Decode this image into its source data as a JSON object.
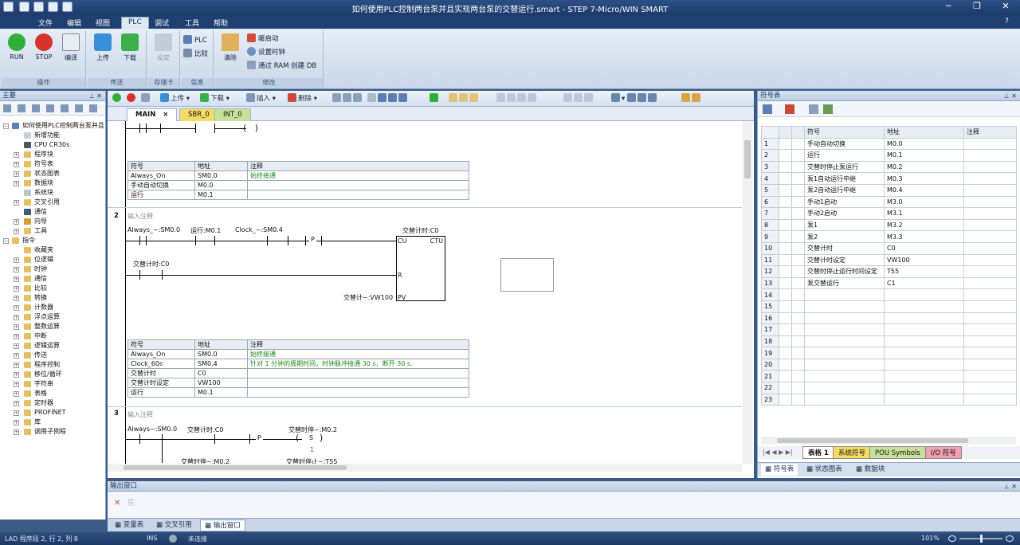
{
  "window": {
    "title": "如何使用PLC控制两台泵并且实现两台泵的交替运行.smart - STEP 7-Micro/WIN SMART"
  },
  "menu": [
    "文件",
    "编辑",
    "视图",
    "PLC",
    "调试",
    "工具",
    "帮助"
  ],
  "ribbon": {
    "run": "RUN",
    "stop": "STOP",
    "compile": "编译",
    "upload": "上传",
    "download": "下载",
    "settings": "设定",
    "plc": "PLC",
    "compare": "比较",
    "clear": "清除",
    "warm_restart": "暖启动",
    "set_clock": "设置时钟",
    "ram_to_db": "通过 RAM 创建 DB",
    "groups": [
      "操作",
      "传送",
      "存储卡",
      "信息",
      "修改"
    ]
  },
  "left_panel": {
    "title": "主要",
    "project_root": "如何使用PLC控制两台泵并且",
    "project_items": [
      "新增功能",
      "CPU CR30s",
      "程序块",
      "符号表",
      "状态图表",
      "数据块",
      "系统块",
      "交叉引用",
      "通信",
      "向导",
      "工具"
    ],
    "instructions_root": "指令",
    "instruction_items": [
      "收藏夹",
      "位逻辑",
      "时钟",
      "通信",
      "比较",
      "转换",
      "计数器",
      "浮点运算",
      "整数运算",
      "中断",
      "逻辑运算",
      "传送",
      "程序控制",
      "移位/循环",
      "字符串",
      "表格",
      "定时器",
      "PROFINET",
      "库",
      "调用子例程"
    ]
  },
  "editor": {
    "toolbar": {
      "upload": "上传",
      "download": "下载",
      "insert": "插入",
      "delete": "删除"
    },
    "tabs": [
      "MAIN",
      "SBR_0",
      "INT_0"
    ],
    "tab_close": "×",
    "net1_table": {
      "headers": [
        "符号",
        "地址",
        "注释"
      ],
      "rows": [
        [
          "Always_On",
          "SM0.0",
          "始终接通"
        ],
        [
          "手动自动切换",
          "M0.0",
          ""
        ],
        [
          "运行",
          "M0.1",
          ""
        ]
      ]
    },
    "net2": {
      "num": "2",
      "comment": "输入注释",
      "contacts": [
        "Always_~:SM0.0",
        "运行:M0.1",
        "Clock_~:SM0.4"
      ],
      "p": "P",
      "counter_title": "交替计时:C0",
      "cu": "CU",
      "ctu": "CTU",
      "r": "R",
      "pv": "PV",
      "reset_contact": "交替计时:C0",
      "pv_input": "交替计~:VW100"
    },
    "net2_table": {
      "headers": [
        "符号",
        "地址",
        "注释"
      ],
      "rows": [
        [
          "Always_On",
          "SM0.0",
          "始终接通"
        ],
        [
          "Clock_60s",
          "SM0.4",
          "针对 1 分钟的周期时间，时钟脉冲接通 30 s，断开 30 s."
        ],
        [
          "交替计时",
          "C0",
          ""
        ],
        [
          "交替计时设定",
          "VW100",
          ""
        ],
        [
          "运行",
          "M0.1",
          ""
        ]
      ]
    },
    "net3": {
      "num": "3",
      "comment": "输入注释",
      "contacts": [
        "Always~:SM0.0",
        "交替计时:C0"
      ],
      "p": "P",
      "coil_label": "交替时停~:M0.2",
      "coil": "S",
      "coil_n": "1",
      "below1": "交替时停~:M0.2",
      "below2": "交替时停止~:T55"
    }
  },
  "symbol_table": {
    "title": "符号表",
    "headers": [
      "符号",
      "地址",
      "注释"
    ],
    "rows": [
      [
        "1",
        "手动自动切换",
        "M0.0"
      ],
      [
        "2",
        "运行",
        "M0.1"
      ],
      [
        "3",
        "交替时停止泵运行",
        "M0.2"
      ],
      [
        "4",
        "泵1自动运行中继",
        "M0.3"
      ],
      [
        "5",
        "泵2自动运行中继",
        "M0.4"
      ],
      [
        "6",
        "手动1启动",
        "M3.0"
      ],
      [
        "7",
        "手动2启动",
        "M3.1"
      ],
      [
        "8",
        "泵1",
        "M3.2"
      ],
      [
        "9",
        "泵2",
        "M3.3"
      ],
      [
        "10",
        "交替计时",
        "C0"
      ],
      [
        "11",
        "交替计时设定",
        "VW100"
      ],
      [
        "12",
        "交替时停止运行时间设定",
        "T55"
      ],
      [
        "13",
        "泵交替运行",
        "C1"
      ],
      [
        "14",
        "",
        ""
      ],
      [
        "15",
        "",
        ""
      ],
      [
        "16",
        "",
        ""
      ],
      [
        "17",
        "",
        ""
      ],
      [
        "18",
        "",
        ""
      ],
      [
        "19",
        "",
        ""
      ],
      [
        "20",
        "",
        ""
      ],
      [
        "21",
        "",
        ""
      ],
      [
        "22",
        "",
        ""
      ],
      [
        "23",
        "",
        ""
      ]
    ],
    "sheet_tabs": [
      "表格 1",
      "系统符号",
      "POU Symbols",
      "I/O 符号"
    ],
    "bottom_tabs": [
      "符号表",
      "状态图表",
      "数据块"
    ]
  },
  "output": {
    "title": "输出窗口"
  },
  "bottom_tabs": [
    "变量表",
    "交叉引用",
    "输出窗口"
  ],
  "status": {
    "position": "LAD 程序段 2, 行 2, 列 8",
    "mode": "INS",
    "connection": "未连接",
    "zoom": "101%"
  }
}
